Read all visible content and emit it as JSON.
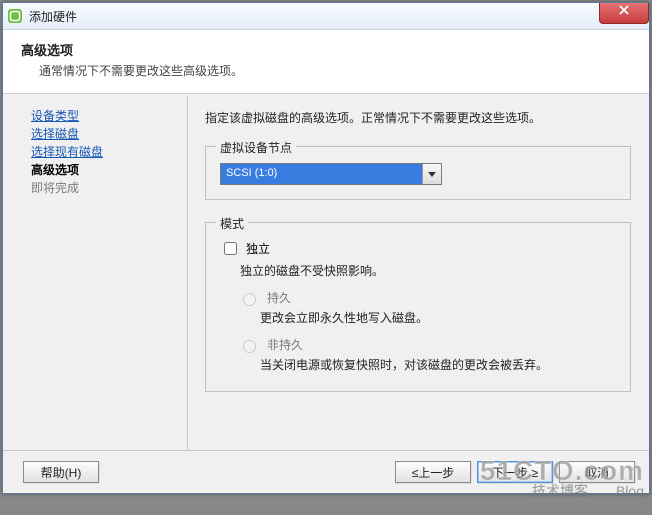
{
  "window": {
    "title": "添加硬件"
  },
  "header": {
    "title": "高级选项",
    "subtitle": "通常情况下不需要更改这些高级选项。"
  },
  "sidebar": {
    "steps": [
      {
        "label": "设备类型",
        "state": "done"
      },
      {
        "label": "选择磁盘",
        "state": "done"
      },
      {
        "label": "选择现有磁盘",
        "state": "done"
      },
      {
        "label": "高级选项",
        "state": "active"
      },
      {
        "label": "即将完成",
        "state": "pending"
      }
    ]
  },
  "main": {
    "instruction": "指定该虚拟磁盘的高级选项。正常情况下不需要更改这些选项。",
    "node_group": {
      "legend": "虚拟设备节点",
      "selected": "SCSI (1:0)"
    },
    "mode_group": {
      "legend": "模式",
      "independent_label": "独立",
      "independent_desc": "独立的磁盘不受快照影响。",
      "persist_label": "持久",
      "persist_desc": "更改会立即永久性地写入磁盘。",
      "nonpersist_label": "非持久",
      "nonpersist_desc": "当关闭电源或恢复快照时，对该磁盘的更改会被丢弃。"
    }
  },
  "footer": {
    "help": "帮助(H)",
    "back": "≤上一步",
    "next": "下一步 ≥",
    "cancel": "取消"
  },
  "watermark": {
    "domain": "51CTO.com",
    "sub": "技术博客　　Blog"
  }
}
